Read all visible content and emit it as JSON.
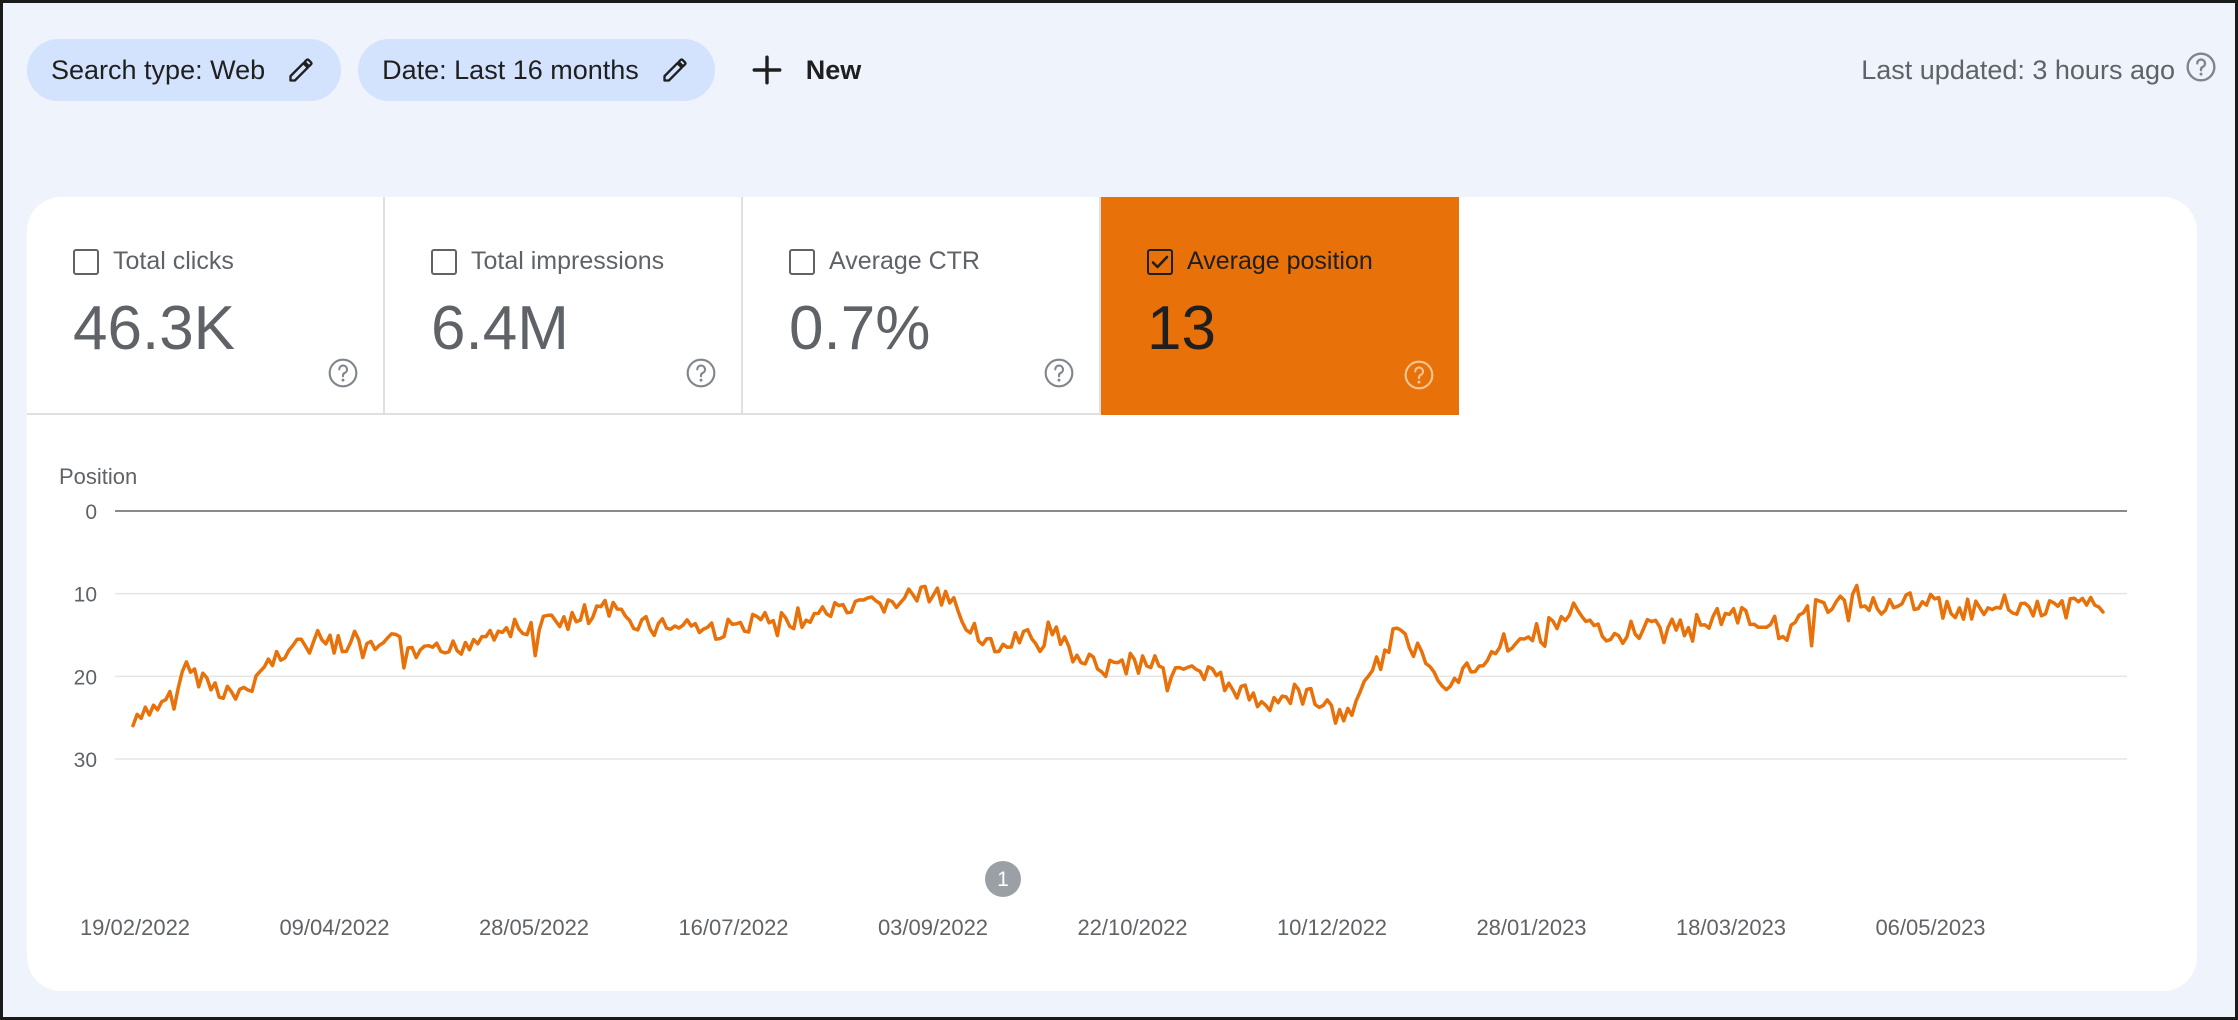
{
  "toolbar": {
    "chips": [
      {
        "label": "Search type: Web",
        "icon": "pencil-icon"
      },
      {
        "label": "Date: Last 16 months",
        "icon": "pencil-icon"
      }
    ],
    "new_label": "New",
    "last_updated": "Last updated: 3 hours ago"
  },
  "metrics": [
    {
      "label": "Total clicks",
      "value": "46.3K",
      "checked": false
    },
    {
      "label": "Total impressions",
      "value": "6.4M",
      "checked": false
    },
    {
      "label": "Average CTR",
      "value": "0.7%",
      "checked": false
    },
    {
      "label": "Average position",
      "value": "13",
      "checked": true
    }
  ],
  "colors": {
    "accent": "#e8710a",
    "chip_bg": "#d3e3fd",
    "page_bg": "#eff3fb",
    "annotation_marker": "#9aa0a6"
  },
  "annotation": {
    "label": "1",
    "date": "2022-08-25"
  },
  "chart_data": {
    "type": "line",
    "ylabel": "Position",
    "y_inverted": true,
    "ylim": [
      0,
      30
    ],
    "yticks": [
      0,
      10,
      20,
      30
    ],
    "grid": true,
    "x_tick_labels": [
      "19/02/2022",
      "09/04/2022",
      "28/05/2022",
      "16/07/2022",
      "03/09/2022",
      "22/10/2022",
      "10/12/2022",
      "28/01/2023",
      "18/03/2023",
      "06/05/2023"
    ],
    "x_start": "2022-02-19",
    "x_end": "2023-06-16",
    "series": [
      {
        "color": "#e8710a",
        "x_step_days": 7,
        "values": [
          26,
          23.5,
          19,
          21,
          22.5,
          19,
          16,
          15.5,
          16.5,
          17,
          16,
          17.5,
          17,
          15.5,
          14,
          14.5,
          13,
          13.5,
          12,
          13,
          14,
          13.5,
          14.5,
          14,
          13,
          13.5,
          12,
          12.5,
          11.5,
          11,
          10,
          11,
          14,
          17.5,
          15,
          15.5,
          17,
          19,
          18.5,
          18,
          19.5,
          20,
          21.5,
          23.5,
          22,
          22.5,
          25.5,
          21,
          15,
          17,
          20.5,
          19,
          16,
          15.5,
          14,
          12,
          16,
          14.5,
          14,
          14,
          13,
          12.5,
          13,
          15,
          12,
          10.5,
          11,
          11.5,
          11,
          11.5,
          12,
          11,
          11.5,
          12,
          11.5,
          11
        ]
      }
    ]
  }
}
